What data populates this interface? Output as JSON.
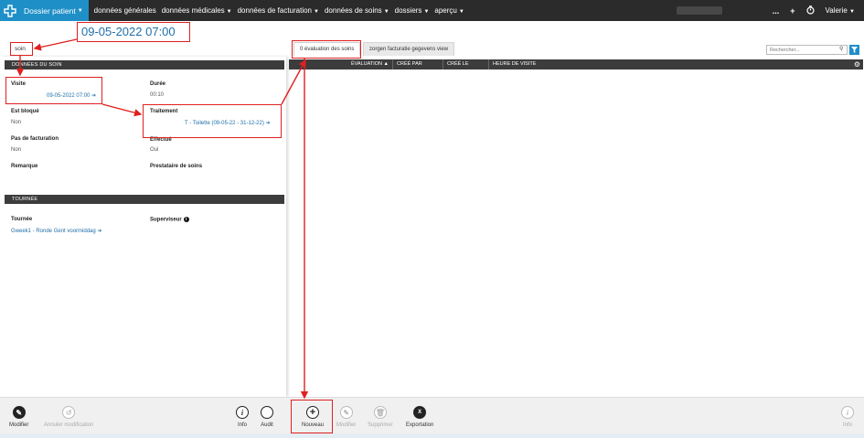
{
  "nav": {
    "brand": "Dossier patient",
    "menu": [
      "données générales",
      "données médicales",
      "données de facturation",
      "données de soins",
      "dossiers",
      "aperçu"
    ],
    "more": "...",
    "plus": "+",
    "user": "Valerie"
  },
  "header": {
    "date_title": "09-05-2022 07:00",
    "breadcrumb": "soin"
  },
  "care_data": {
    "section_title": "DONNÉES DU SOIN",
    "visite_label": "Visite",
    "visite_value": "09-05-2022 07:00",
    "duree_label": "Durée",
    "duree_value": "00:10",
    "est_bloque_label": "Est bloqué",
    "est_bloque_value": "Non",
    "traitement_label": "Traitement",
    "traitement_value": "T - Toilette (09-05-22 - 31-12-22)",
    "pas_facturation_label": "Pas de facturation",
    "pas_facturation_value": "Non",
    "effectue_label": "Effectué",
    "effectue_value": "Oui",
    "remarque_label": "Remarque",
    "prestataire_label": "Prestataire de soins"
  },
  "tour": {
    "section_title": "TOURNÉE",
    "tournee_label": "Tournée",
    "tournee_value": "Gweek1 - Ronde Gent voormiddag",
    "superviseur_label": "Superviseur"
  },
  "tabs": [
    "0 évaluation des soins",
    "zorgen facturatie gegevens view"
  ],
  "search": {
    "placeholder": "Rechercher..."
  },
  "grid": {
    "columns": [
      "ÉVALUATION ▲",
      "CRÉÉ PAR",
      "CRÉÉ LE",
      "HEURE DE VISITE"
    ]
  },
  "toolbar": {
    "modifier": "Modifier",
    "annuler": "Annuler modification",
    "info": "Info",
    "audit": "Audit",
    "nouveau": "Nouveau",
    "modifier2": "Modifier",
    "supprimer": "Supprimer",
    "exportation": "Exportation",
    "info_right": "Info"
  },
  "colors": {
    "accent": "#1f8fc7",
    "link": "#1f6fa8",
    "annotation": "#e02020",
    "header_dark": "#3c3c3c"
  }
}
